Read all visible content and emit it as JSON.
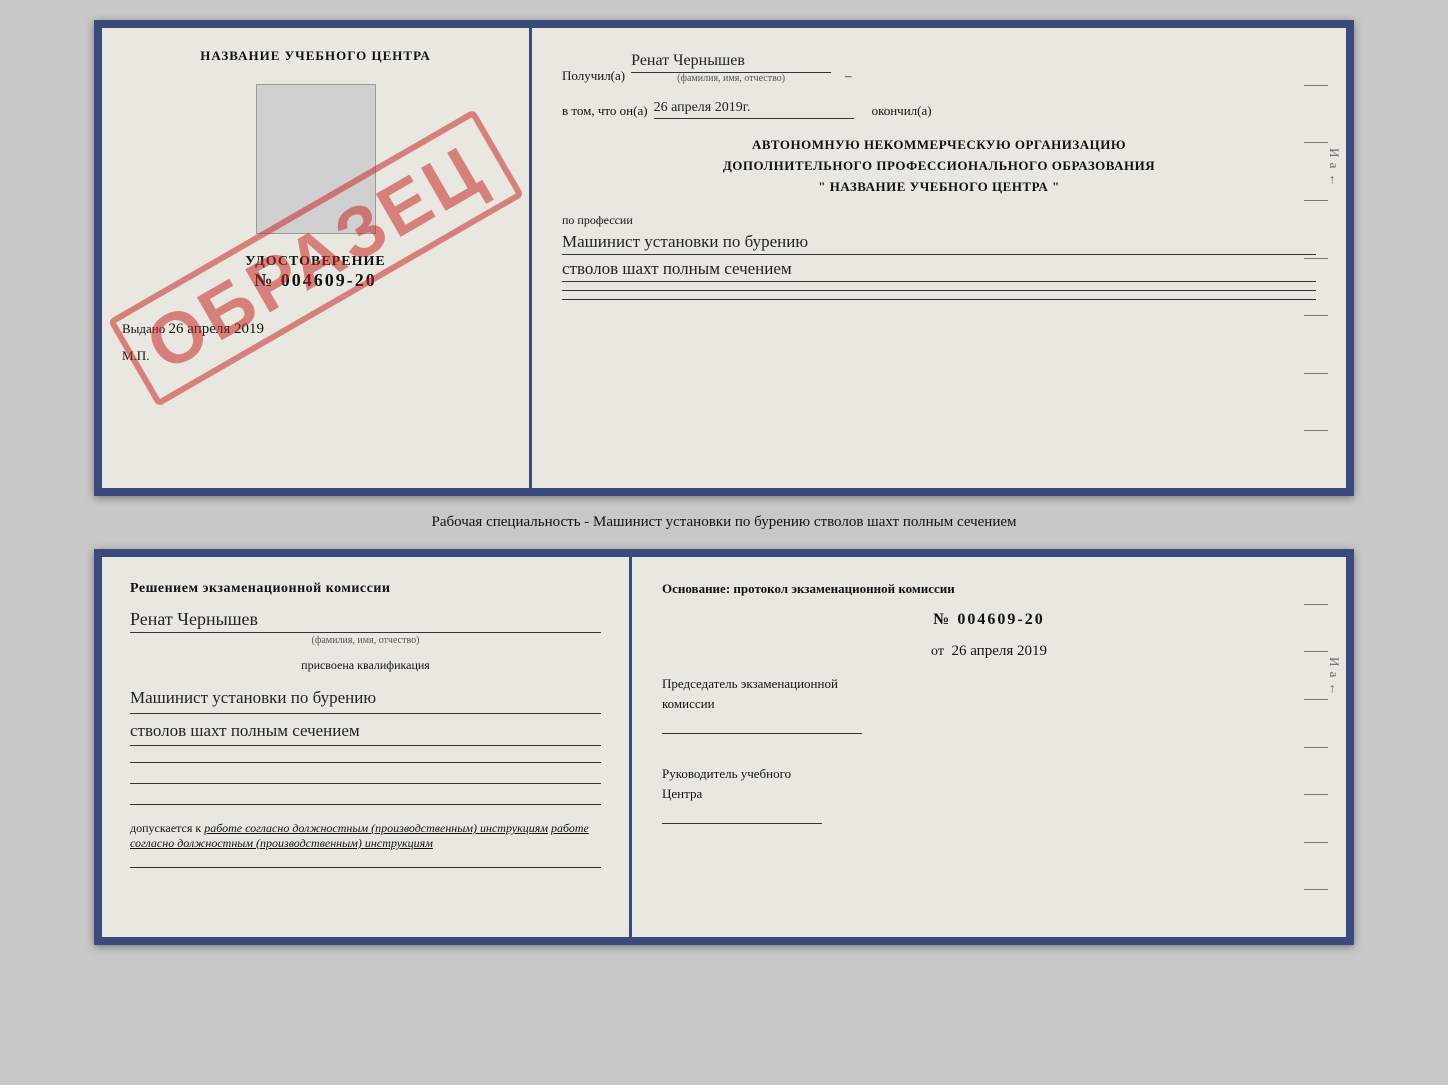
{
  "top_certificate": {
    "left": {
      "title": "НАЗВАНИЕ УЧЕБНОГО ЦЕНТРА",
      "udostoverenie_label": "УДОСТОВЕРЕНИЕ",
      "number": "№ 004609-20",
      "vydano_label": "Выдано",
      "vydano_date": "26 апреля 2019",
      "mp_label": "М.П.",
      "stamp_text": "ОБРАЗЕЦ"
    },
    "right": {
      "poluchil_label": "Получил(а)",
      "poluchil_name": "Ренат Чернышев",
      "fio_hint": "(фамилия, имя, отчество)",
      "vtom_label": "в том, что он(а)",
      "vtom_date": "26 апреля 2019г.",
      "okonchil_label": "окончил(а)",
      "org_line1": "АВТОНОМНУЮ НЕКОММЕРЧЕСКУЮ ОРГАНИЗАЦИЮ",
      "org_line2": "ДОПОЛНИТЕЛЬНОГО ПРОФЕССИОНАЛЬНОГО ОБРАЗОВАНИЯ",
      "org_line3": "\"  НАЗВАНИЕ УЧЕБНОГО ЦЕНТРА  \"",
      "po_professii_label": "по профессии",
      "profession_line1": "Машинист установки по бурению",
      "profession_line2": "стволов шахт полным сечением"
    }
  },
  "specialty_text": "Рабочая специальность - Машинист установки по бурению стволов шахт полным сечением",
  "bottom_certificate": {
    "left": {
      "title": "Решением экзаменационной комиссии",
      "name_handwritten": "Ренат Чернышев",
      "fio_hint": "(фамилия, имя, отчество)",
      "qual_label": "присвоена квалификация",
      "qual_line1": "Машинист установки по бурению",
      "qual_line2": "стволов шахт полным сечением",
      "dopuskaetsya_label": "допускается к",
      "dopuskaetsya_val": "работе согласно должностным (производственным) инструкциям"
    },
    "right": {
      "osnov_label": "Основание: протокол экзаменационной комиссии",
      "number": "№ 004609-20",
      "ot_label": "от",
      "date": "26 апреля 2019",
      "predsedatel_line1": "Председатель экзаменационной",
      "predsedatel_line2": "комиссии",
      "rukovod_line1": "Руководитель учебного",
      "rukovod_line2": "Центра"
    }
  }
}
